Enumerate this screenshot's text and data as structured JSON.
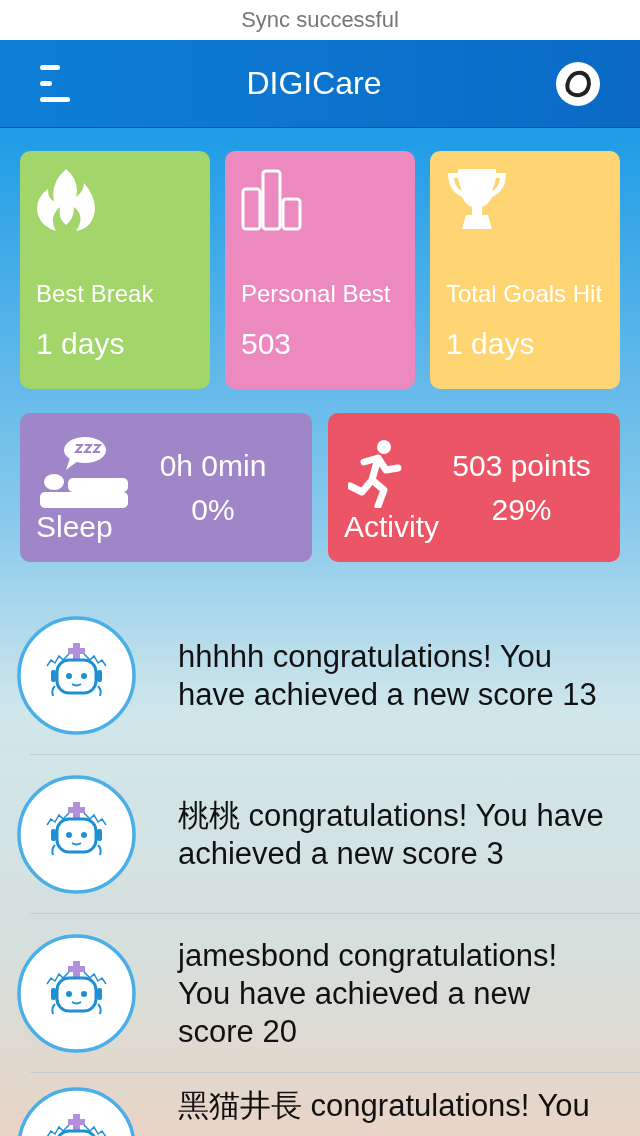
{
  "status_bar": {
    "message": "Sync successful"
  },
  "header": {
    "title": "DIGICare"
  },
  "stat_cards": [
    {
      "kind": "streak",
      "label": "Best Break",
      "value": "1 days",
      "color": "#a2d56a"
    },
    {
      "kind": "record",
      "label": "Personal Best",
      "value": "503",
      "color": "#ec89bf"
    },
    {
      "kind": "goals",
      "label": "Total Goals Hit",
      "value": "1 days",
      "color": "#fed572"
    }
  ],
  "summary_cards": [
    {
      "kind": "sleep",
      "label": "Sleep",
      "value": "0h 0min",
      "percent": "0%",
      "color": "#9e86c8"
    },
    {
      "kind": "activity",
      "label": "Activity",
      "value": "503 points",
      "percent": "29%",
      "color": "#ec5565"
    }
  ],
  "feed": [
    {
      "message": "hhhhh congratulations! You have achieved a new score 13"
    },
    {
      "message": "桃桃 congratulations! You have achieved a new score 3"
    },
    {
      "message": "jamesbond congratulations! You have achieved a new score 20"
    },
    {
      "message": "黑猫井長 congratulations! You"
    }
  ]
}
